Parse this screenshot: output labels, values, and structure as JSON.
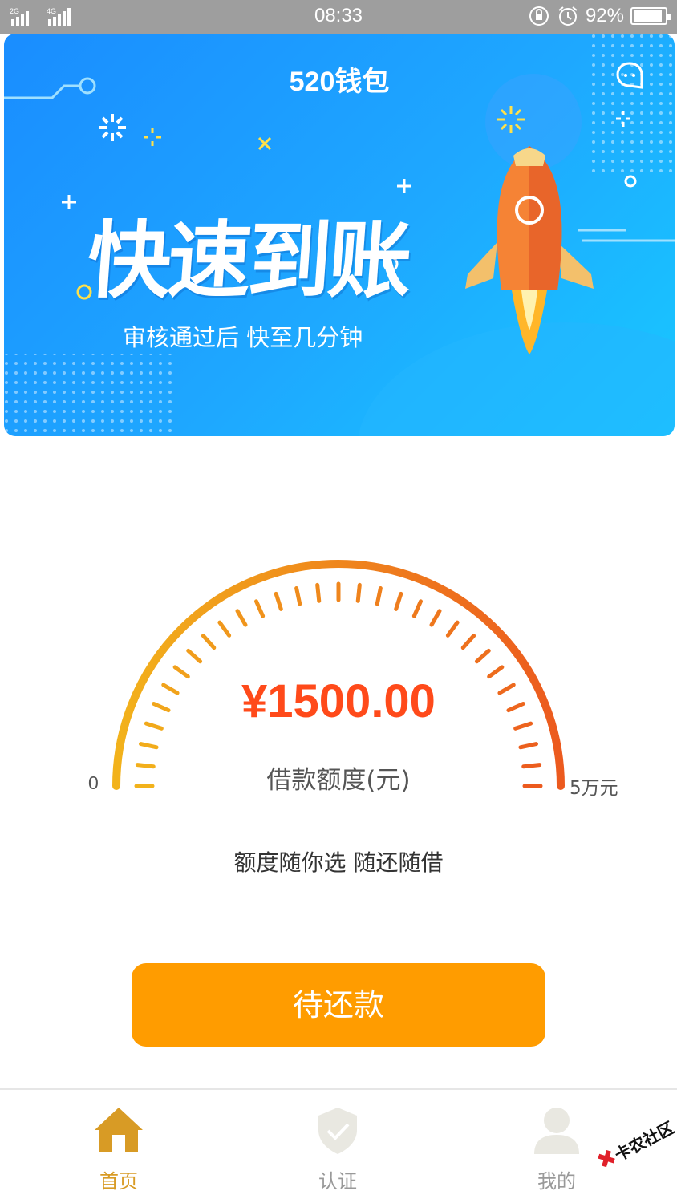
{
  "status_bar": {
    "network": "2G 4G",
    "time": "08:33",
    "battery": "92%",
    "battery_level": 0.92
  },
  "banner": {
    "title": "520钱包",
    "headline": "快速到账",
    "subtitle": "审核通过后  快至几分钟",
    "icons": [
      "chat-bubble-icon",
      "rocket-icon"
    ]
  },
  "gauge": {
    "amount": "¥1500.00",
    "label": "借款额度(元)",
    "min_label": "0",
    "max_label": "5万元",
    "tick_count": 31,
    "colors": {
      "start": "#f2b21b",
      "end": "#ec5a1e"
    }
  },
  "slogan": "额度随你选  随还随借",
  "primary_button": {
    "label": "待还款",
    "color": "#ff9c00"
  },
  "tab_bar": {
    "tabs": [
      {
        "label": "首页",
        "icon": "home-icon",
        "active": true
      },
      {
        "label": "认证",
        "icon": "shield-check-icon",
        "active": false
      },
      {
        "label": "我的",
        "icon": "user-icon",
        "active": false
      }
    ],
    "active_color": "#d89b25"
  },
  "watermark": "卡农社区"
}
